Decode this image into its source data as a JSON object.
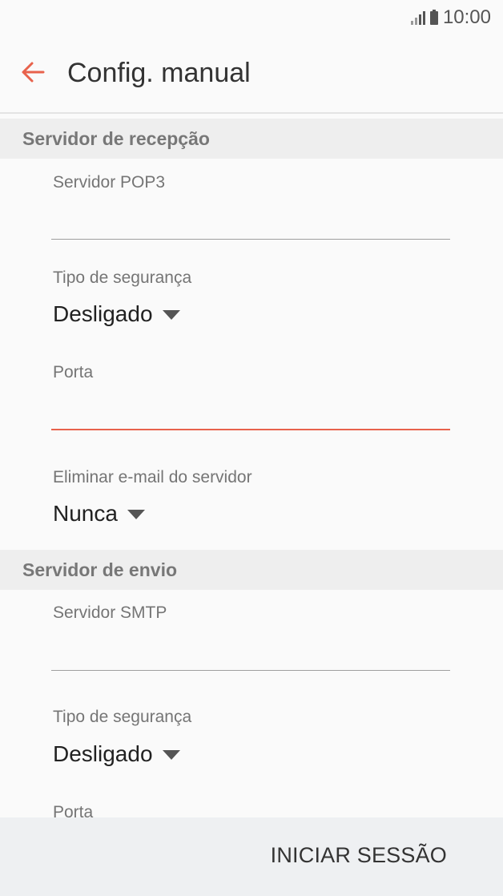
{
  "status_bar": {
    "time": "10:00",
    "signal_icon": "signal-icon",
    "battery_icon": "battery-icon"
  },
  "app_bar": {
    "title": "Config. manual",
    "back_icon": "arrow-left-icon",
    "accent_color": "#e8624c"
  },
  "incoming": {
    "header": "Servidor de recepção",
    "server_label": "Servidor POP3",
    "server_value": "",
    "security_label": "Tipo de segurança",
    "security_value": "Desligado",
    "port_label": "Porta",
    "port_value": "",
    "delete_label": "Eliminar e-mail do servidor",
    "delete_value": "Nunca"
  },
  "outgoing": {
    "header": "Servidor de envio",
    "server_label": "Servidor SMTP",
    "server_value": "",
    "security_label": "Tipo de segurança",
    "security_value": "Desligado",
    "port_label": "Porta"
  },
  "footer": {
    "signin_label": "INICIAR SESSÃO"
  }
}
